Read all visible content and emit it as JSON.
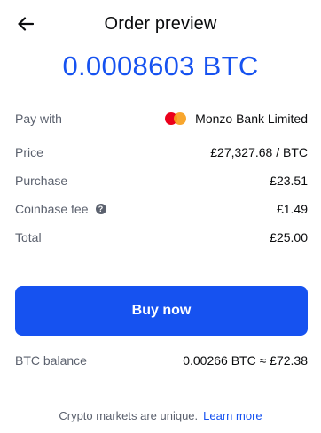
{
  "header": {
    "title": "Order preview",
    "back_icon": "arrow-left-icon"
  },
  "order": {
    "amount": "0.0008603 BTC"
  },
  "details": {
    "pay_with_label": "Pay with",
    "pay_with_value": "Monzo Bank Limited",
    "pay_with_icon": "mastercard-icon",
    "price_label": "Price",
    "price_value": "£27,327.68 / BTC",
    "purchase_label": "Purchase",
    "purchase_value": "£23.51",
    "fee_label": "Coinbase fee",
    "fee_icon": "info-icon",
    "fee_value": "£1.49",
    "total_label": "Total",
    "total_value": "£25.00"
  },
  "actions": {
    "buy_label": "Buy now"
  },
  "balance": {
    "label": "BTC balance",
    "value": "0.00266 BTC ≈ £72.38"
  },
  "footer": {
    "text": "Crypto markets are unique.",
    "link": "Learn more"
  },
  "colors": {
    "accent": "#1652f0",
    "text_primary": "#0a0b0d",
    "text_secondary": "#5b616e",
    "divider": "#e6e8ea",
    "mastercard_red": "#eb001b",
    "mastercard_orange": "#f79e1b"
  }
}
